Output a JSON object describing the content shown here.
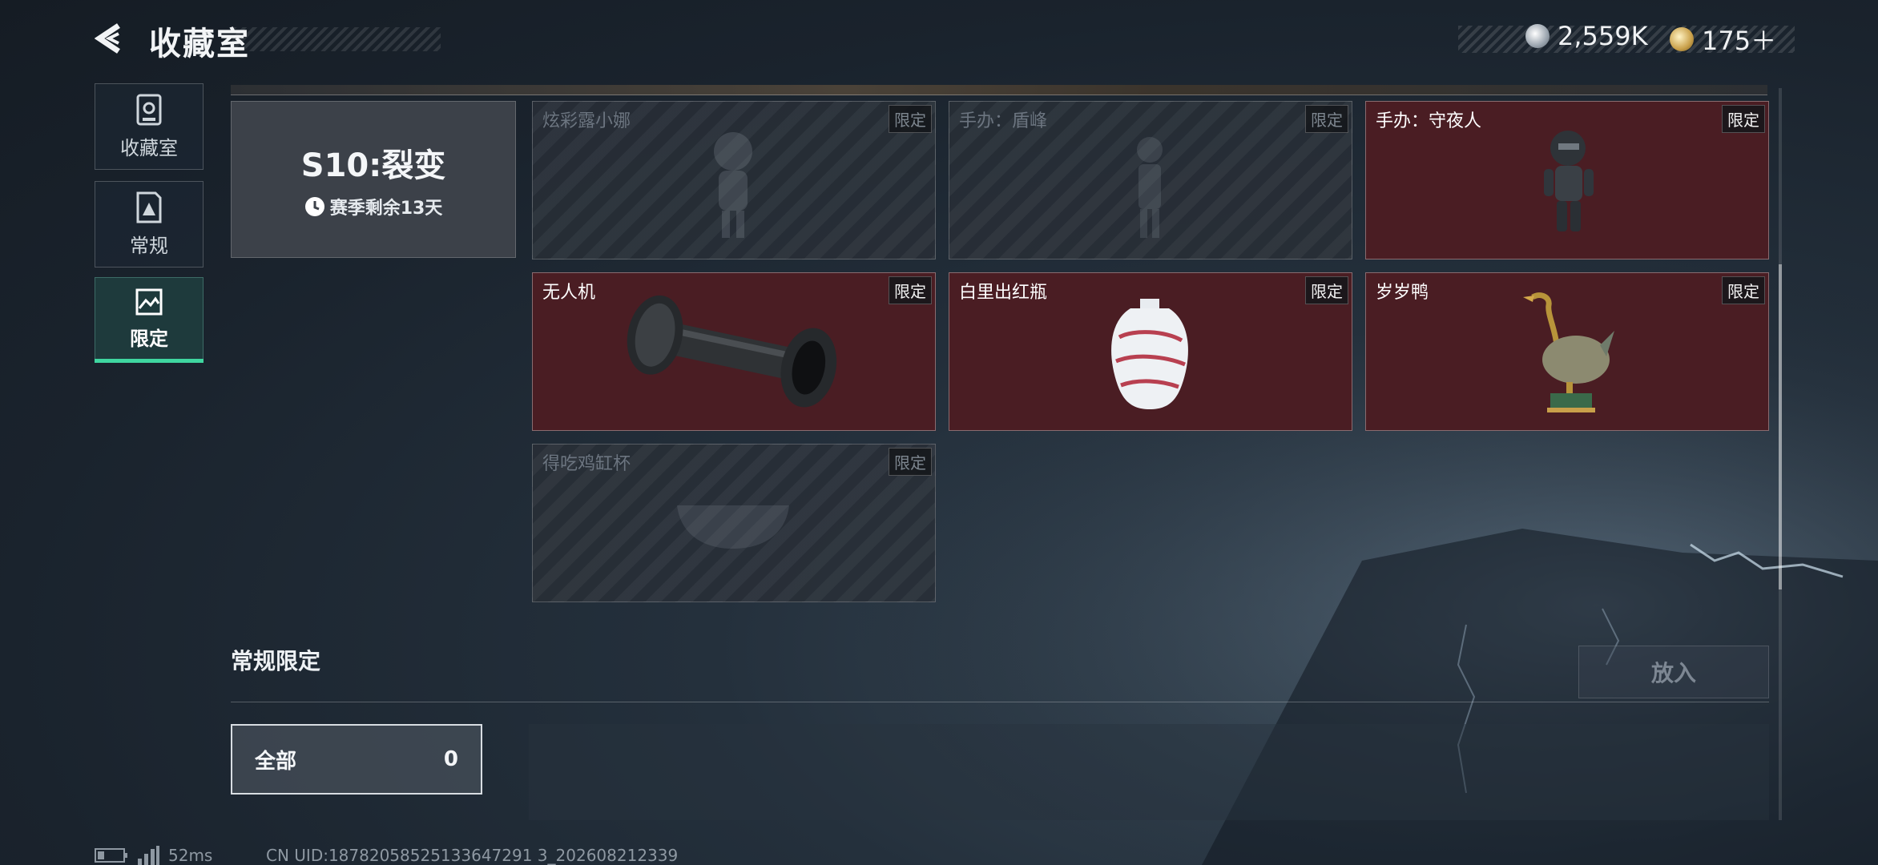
{
  "header": {
    "title": "收藏室",
    "currency_silver": "2,559K",
    "currency_gold": "175＋"
  },
  "nav": {
    "items": [
      {
        "label": "收藏室",
        "icon": "vault-icon"
      },
      {
        "label": "常规",
        "icon": "document-icon"
      },
      {
        "label": "限定",
        "icon": "gallery-icon",
        "active": true
      }
    ]
  },
  "season": {
    "title": "S10:裂变",
    "remaining": "赛季剩余13天"
  },
  "items": [
    {
      "name": "炫彩露小娜",
      "tag": "限定",
      "owned": false
    },
    {
      "name": "手办：盾峰",
      "tag": "限定",
      "owned": false
    },
    {
      "name": "手办：守夜人",
      "tag": "限定",
      "owned": true
    },
    {
      "name": "无人机",
      "tag": "限定",
      "owned": true
    },
    {
      "name": "白里出红瓶",
      "tag": "限定",
      "owned": true
    },
    {
      "name": "岁岁鸭",
      "tag": "限定",
      "owned": true
    },
    {
      "name": "得吃鸡缸杯",
      "tag": "限定",
      "owned": false
    }
  ],
  "section": {
    "title": "常规限定",
    "put_button": "放入",
    "filter_label": "全部",
    "filter_count": "0"
  },
  "footer": {
    "ping": "52ms",
    "uid": "CN UID:18782058525133647291 3_202608212339"
  },
  "colors": {
    "accent": "#3fd6a0",
    "owned_card": "#4a1d23",
    "background": "#1a232d"
  }
}
